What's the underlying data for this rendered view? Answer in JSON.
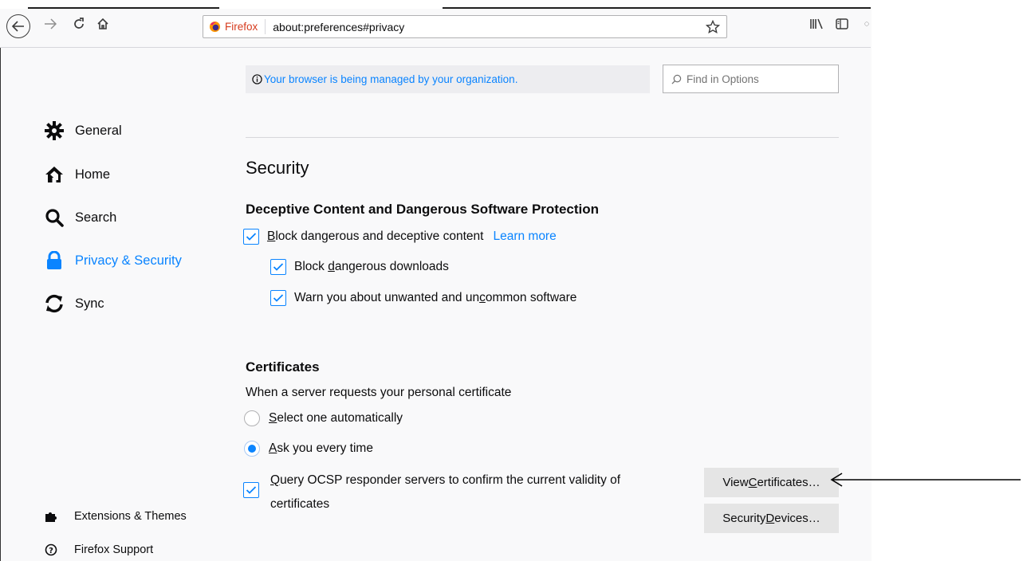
{
  "toolbar": {
    "identity_label": "Firefox",
    "url": "about:preferences#privacy"
  },
  "banner": {
    "text": "Your browser is being managed by your organization."
  },
  "search": {
    "placeholder": "Find in Options"
  },
  "sidebar": {
    "items": [
      {
        "label": "General"
      },
      {
        "label": "Home"
      },
      {
        "label": "Search"
      },
      {
        "label": "Privacy & Security"
      },
      {
        "label": "Sync"
      }
    ],
    "footer": [
      {
        "label": "Extensions & Themes"
      },
      {
        "label": "Firefox Support"
      }
    ]
  },
  "security": {
    "heading": "Security",
    "deceptive": {
      "heading": "Deceptive Content and Dangerous Software Protection",
      "block_label_pre": "",
      "block_label_ul": "B",
      "block_label_post": "lock dangerous and deceptive content",
      "learn_more": "Learn more",
      "downloads_pre": "Block ",
      "downloads_ul": "d",
      "downloads_post": "angerous downloads",
      "unwanted_pre": "Warn you about unwanted and un",
      "unwanted_ul": "c",
      "unwanted_post": "ommon software"
    },
    "certificates": {
      "heading": "Certificates",
      "prompt": "When a server requests your personal certificate",
      "select_ul": "S",
      "select_post": "elect one automatically",
      "ask_ul": "A",
      "ask_post": "sk you every time",
      "ocsp_ul": "Q",
      "ocsp_post": "uery OCSP responder servers to confirm the current validity of",
      "ocsp_line2": "certificates",
      "view_pre": "View ",
      "view_ul": "C",
      "view_post": "ertificates…",
      "devices_pre": "Security ",
      "devices_ul": "D",
      "devices_post": "evices…"
    }
  },
  "colors": {
    "accent": "#0a84ff",
    "background": "#f9f9fa"
  }
}
